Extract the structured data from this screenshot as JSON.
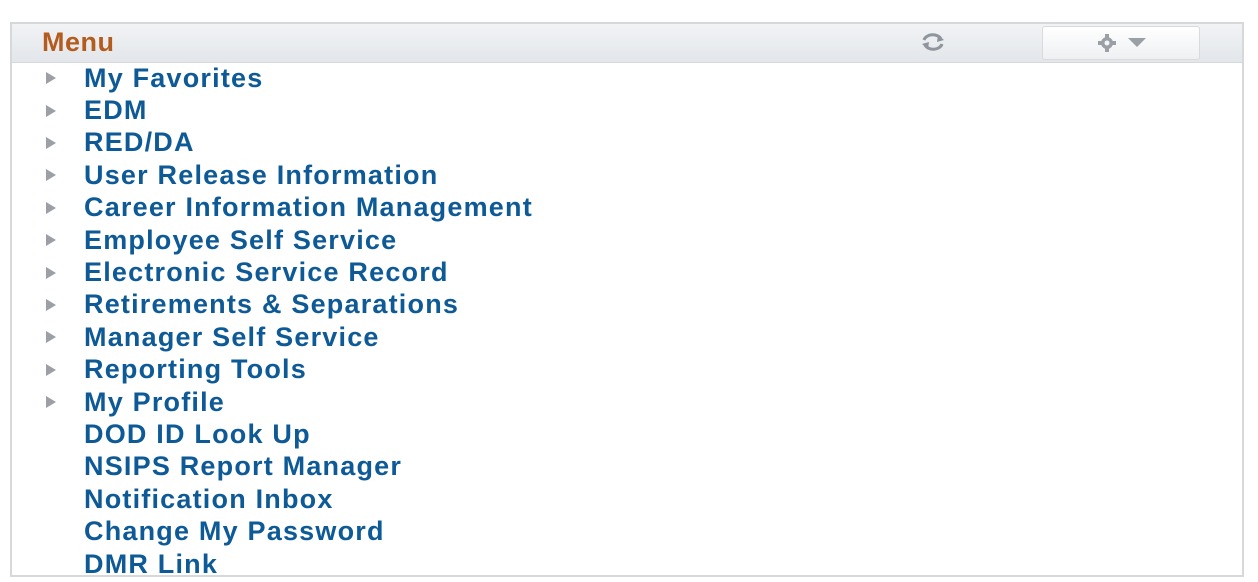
{
  "menu": {
    "title": "Menu",
    "refresh_icon": "refresh-icon",
    "options_icon": "gear-icon",
    "items": [
      {
        "label": "My Favorites",
        "has_children": true
      },
      {
        "label": "EDM",
        "has_children": true
      },
      {
        "label": "RED/DA",
        "has_children": true
      },
      {
        "label": "User Release Information",
        "has_children": true
      },
      {
        "label": "Career Information Management",
        "has_children": true
      },
      {
        "label": "Employee Self Service",
        "has_children": true
      },
      {
        "label": "Electronic Service Record",
        "has_children": true
      },
      {
        "label": "Retirements & Separations",
        "has_children": true
      },
      {
        "label": "Manager Self Service",
        "has_children": true
      },
      {
        "label": "Reporting Tools",
        "has_children": true
      },
      {
        "label": "My Profile",
        "has_children": true
      },
      {
        "label": "DOD ID Look Up",
        "has_children": false
      },
      {
        "label": "NSIPS Report Manager",
        "has_children": false
      },
      {
        "label": "Notification Inbox",
        "has_children": false
      },
      {
        "label": "Change My Password",
        "has_children": false
      },
      {
        "label": "DMR Link",
        "has_children": false
      }
    ]
  },
  "colors": {
    "title": "#b35c1e",
    "link": "#0e5a97",
    "arrow": "#9aa0a6",
    "header_bg": "#e8ebee"
  }
}
